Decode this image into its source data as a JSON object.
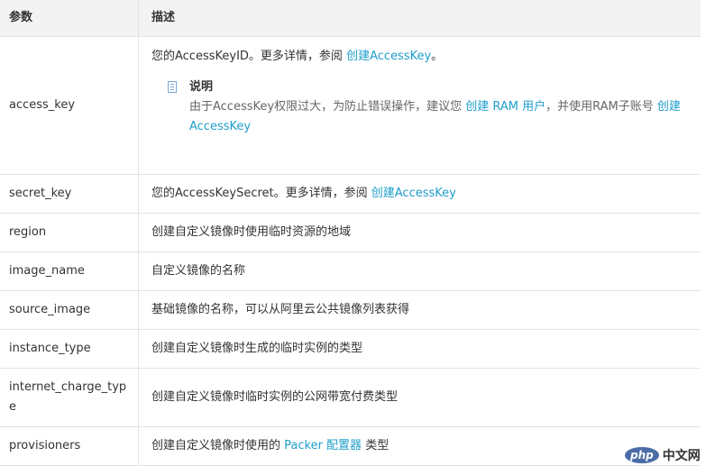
{
  "table": {
    "headers": {
      "param": "参数",
      "desc": "描述"
    },
    "rows": [
      {
        "param": "access_key",
        "desc": {
          "pre": "您的AccessKeyID。更多详情，参阅 ",
          "link": "创建AccessKey",
          "post": "。"
        },
        "note": {
          "title": "说明",
          "pre": "由于AccessKey权限过大，为防止错误操作，建议您 ",
          "link1": "创建 RAM 用户",
          "mid": "，并使用RAM子账号 ",
          "link2": "创建AccessKey"
        }
      },
      {
        "param": "secret_key",
        "desc": {
          "pre": "您的AccessKeySecret。更多详情，参阅 ",
          "link": "创建AccessKey"
        }
      },
      {
        "param": "region",
        "desc": "创建自定义镜像时使用临时资源的地域"
      },
      {
        "param": "image_name",
        "desc": "自定义镜像的名称"
      },
      {
        "param": "source_image",
        "desc": "基础镜像的名称，可以从阿里云公共镜像列表获得"
      },
      {
        "param": "instance_type",
        "desc": "创建自定义镜像时生成的临时实例的类型"
      },
      {
        "param": "internet_charge_type",
        "desc": "创建自定义镜像时临时实例的公网带宽付费类型"
      },
      {
        "param": "provisioners",
        "desc": {
          "pre": "创建自定义镜像时使用的 ",
          "link": "Packer 配置器",
          "post": " 类型"
        }
      }
    ]
  },
  "watermark": {
    "logo": "php",
    "text": "中文网"
  }
}
